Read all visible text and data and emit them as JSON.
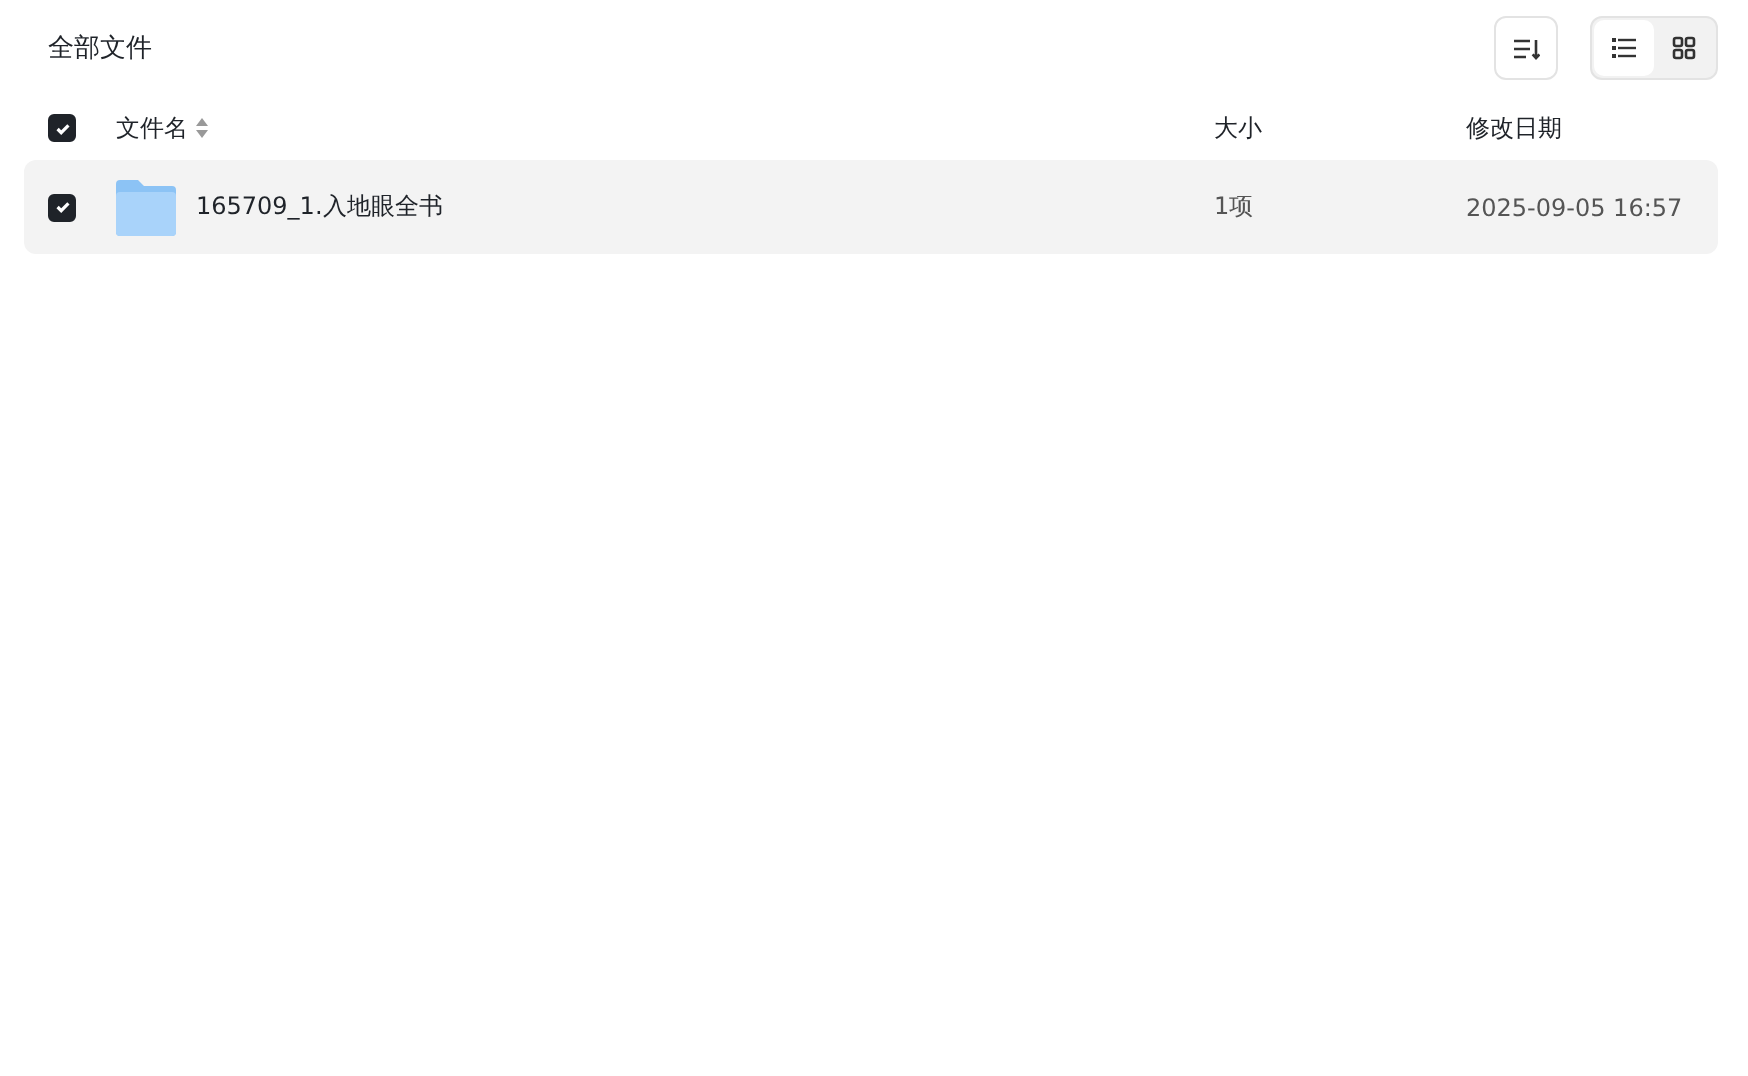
{
  "breadcrumb": "全部文件",
  "view_modes": [
    {
      "kind": "list",
      "selected": true
    },
    {
      "kind": "grid",
      "selected": false
    }
  ],
  "table": {
    "select_all_checked": true,
    "columns": [
      "文件名",
      "大小",
      "修改日期"
    ],
    "rows": [
      {
        "kind": "folder",
        "checked": true,
        "name": "165709_1.入地眼全书",
        "size": "1项",
        "modified": "2025-09-05 16:57"
      }
    ]
  }
}
